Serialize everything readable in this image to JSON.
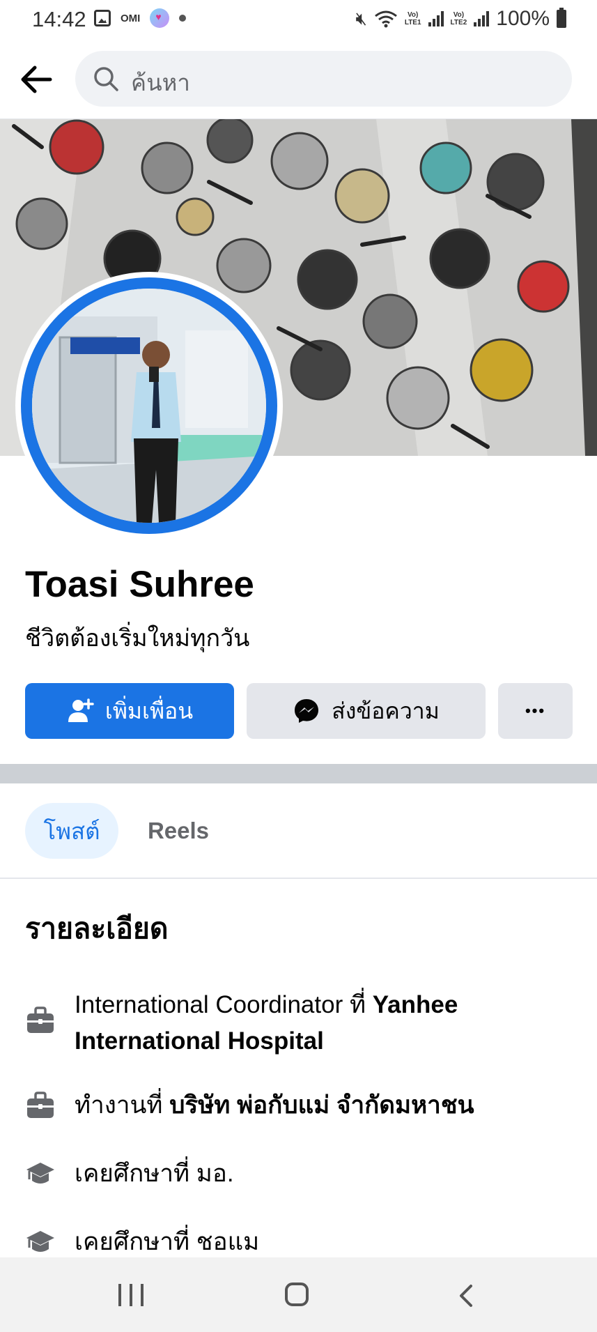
{
  "status_bar": {
    "time": "14:42",
    "notification_text": "OMI",
    "lte1": "Vo)\nLTE1",
    "lte2": "Vo)\nLTE2",
    "battery": "100%"
  },
  "header": {
    "search_placeholder": "ค้นหา"
  },
  "profile": {
    "name": "Toasi Suhree",
    "bio": "ชีวิตต้องเริ่มใหม่ทุกวัน",
    "add_friend_label": "เพิ่มเพื่อน",
    "message_label": "ส่งข้อความ",
    "more_label": "•••"
  },
  "tabs": [
    {
      "label": "โพสต์",
      "active": true
    },
    {
      "label": "Reels",
      "active": false
    }
  ],
  "details": {
    "title": "รายละเอียด",
    "items": [
      {
        "icon": "briefcase-icon",
        "prefix": "International Coordinator ที่ ",
        "bold": "Yanhee International Hospital"
      },
      {
        "icon": "briefcase-icon",
        "prefix": "ทำงานที่ ",
        "bold": "บริษัท พ่อกับแม่ จำกัดมหาชน"
      },
      {
        "icon": "graduation-cap-icon",
        "prefix": "เคยศึกษาที่ มอ.",
        "bold": ""
      },
      {
        "icon": "graduation-cap-icon",
        "prefix": "เคยศึกษาที่ ชอแม",
        "bold": ""
      }
    ]
  },
  "colors": {
    "accent": "#1b74e4",
    "button_gray": "#e4e6eb",
    "tab_active_bg": "#e7f3ff",
    "text_secondary": "#65676b"
  }
}
